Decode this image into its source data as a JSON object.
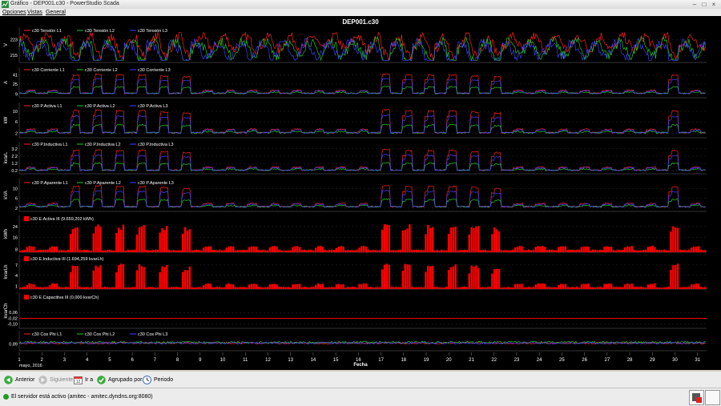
{
  "window": {
    "title": "Gráfico - DEP001.c30 - PowerStudio Scada",
    "icon": "chart-app-icon"
  },
  "menu": [
    "Opciones",
    "Vistas",
    "General"
  ],
  "chart_title": "DEP001.c30",
  "colors": {
    "l1": "#ff2020",
    "l2": "#1ecb1e",
    "l3": "#4040ff",
    "bar": "#ff0000",
    "bg": "#000000",
    "grid": "#3a3a3a",
    "text": "#ffffff"
  },
  "chart_data": [
    {
      "type": "line",
      "ylabel": "V",
      "yticks": [
        "223",
        "215"
      ],
      "series": [
        {
          "name": "c30 Tensión L1"
        },
        {
          "name": "c30 Tensión L2"
        },
        {
          "name": "c30 Tensión L3"
        }
      ]
    },
    {
      "type": "line",
      "ylabel": "A",
      "yticks": [
        "41",
        "25",
        "9"
      ],
      "series": [
        {
          "name": "c30 Corriente L1"
        },
        {
          "name": "c30 Corriente L2"
        },
        {
          "name": "c30 Corriente L3"
        }
      ]
    },
    {
      "type": "line",
      "ylabel": "kW",
      "yticks": [
        "10",
        "6",
        "2"
      ],
      "series": [
        {
          "name": "c30 P.Activa L1"
        },
        {
          "name": "c30 P.Activa L2"
        },
        {
          "name": "c30 P.Activa L3"
        }
      ]
    },
    {
      "type": "line",
      "ylabel": "kvarL",
      "yticks": [
        "3.2",
        "2.2",
        "1.2",
        "0.2"
      ],
      "series": [
        {
          "name": "c30 P.Inductiva L1"
        },
        {
          "name": "c30 P.Inductiva L2"
        },
        {
          "name": "c30 P.Inductiva L3"
        }
      ]
    },
    {
      "type": "line",
      "ylabel": "kVA",
      "yticks": [
        "10",
        "6",
        "2"
      ],
      "series": [
        {
          "name": "c30 P.Aparente L1"
        },
        {
          "name": "c30 P.Aparente L2"
        },
        {
          "name": "c30 P.Aparente L3"
        }
      ]
    },
    {
      "type": "bar",
      "ylabel": "kWh",
      "yticks": [
        "24",
        "16",
        "8"
      ],
      "series": [
        {
          "name": "c30 E.Activa III (9.659,202 kWh)"
        }
      ]
    },
    {
      "type": "bar",
      "ylabel": "kvarLh",
      "yticks": [
        "7",
        "4",
        "1"
      ],
      "series": [
        {
          "name": "c30 E.Inductiva III (1.694,259 kvarLh)"
        }
      ]
    },
    {
      "type": "bar",
      "ylabel": "kvarCh",
      "yticks": [
        "0,06",
        "-0,02",
        "-0,10"
      ],
      "series": [
        {
          "name": "c30 E.Capacitiva III (0,000 kvarCh)"
        }
      ]
    },
    {
      "type": "line",
      "ylabel": "",
      "yticks": [
        "0.89"
      ],
      "series": [
        {
          "name": "c30 Cos Phi L1"
        },
        {
          "name": "c30 Cos Phi L2"
        },
        {
          "name": "c30 Cos Phi L3"
        }
      ]
    }
  ],
  "x_axis": {
    "ticks": [
      "1",
      "2",
      "3",
      "4",
      "5",
      "6",
      "7",
      "8",
      "9",
      "10",
      "11",
      "12",
      "13",
      "14",
      "15",
      "16",
      "17",
      "18",
      "19",
      "20",
      "21",
      "22",
      "23",
      "24",
      "25",
      "26",
      "27",
      "28",
      "29",
      "30",
      "31"
    ],
    "month_label": "mayo, 2016",
    "label": "Fecha"
  },
  "day_profile": [
    0.15,
    0.15,
    0.95,
    0.98,
    0.95,
    0.95,
    0.9,
    0.85,
    0.15,
    0.15,
    0.15,
    0.15,
    0.15,
    0.15,
    0.15,
    0.15,
    1.0,
    0.95,
    0.95,
    0.95,
    0.9,
    0.85,
    0.15,
    0.15,
    0.15,
    0.15,
    0.15,
    0.15,
    0.15,
    0.95,
    0.15
  ],
  "toolbar": [
    {
      "label": "Anterior",
      "icon": "arrow-left-icon"
    },
    {
      "label": "Siguiente",
      "icon": "arrow-right-icon"
    },
    {
      "label": "Ir a",
      "icon": "calendar-icon"
    },
    {
      "label": "Agrupado por",
      "icon": "group-icon"
    },
    {
      "label": "Periodo",
      "icon": "clock-icon"
    }
  ],
  "status": "El servidor está activo (amitec - amitec.dyndns.org:8080)"
}
